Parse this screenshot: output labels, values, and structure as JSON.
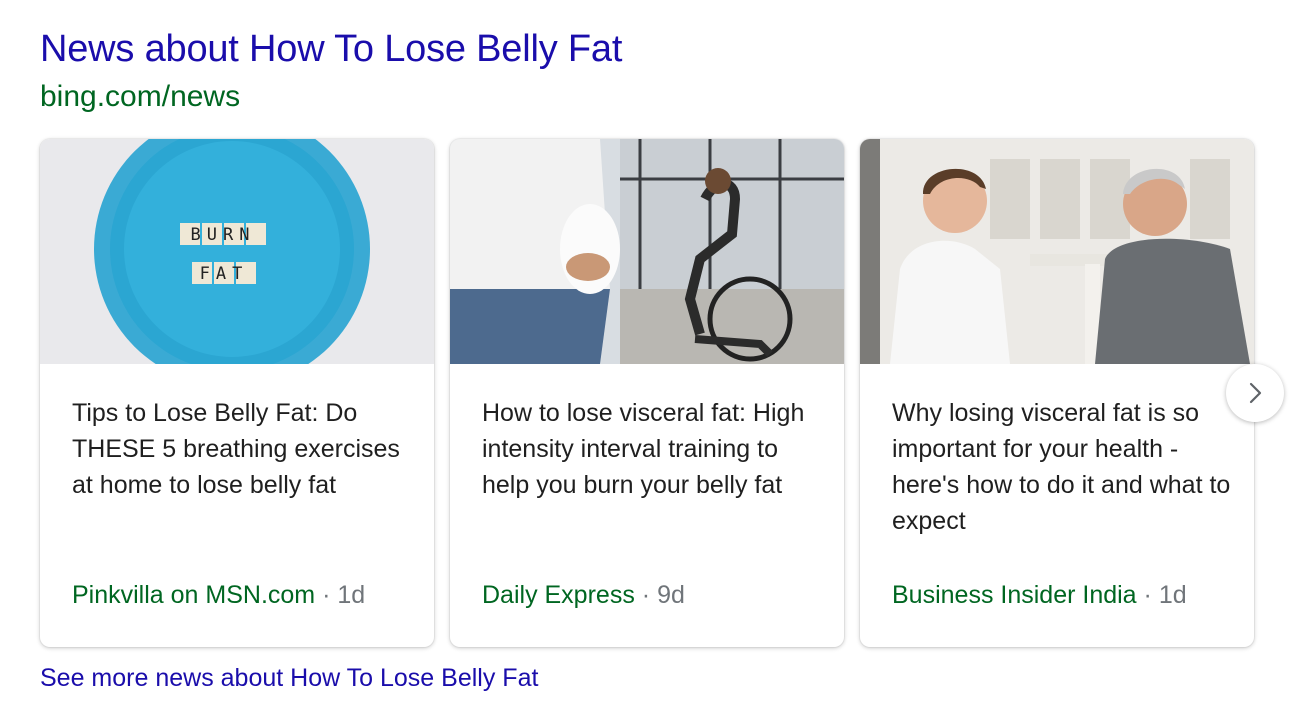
{
  "header": {
    "title": "News about How To Lose Belly Fat",
    "source": "bing.com/news"
  },
  "cards": [
    {
      "headline": "Tips to Lose Belly Fat: Do THESE 5 breathing exercises at home to lose belly fat",
      "source": "Pinkvilla on MSN.com",
      "separator": "·",
      "age": "1d",
      "image_text_1": "BURN",
      "image_text_2": "FAT"
    },
    {
      "headline": "How to lose visceral fat: High intensity interval training to help you burn your belly fat",
      "source": "Daily Express",
      "separator": "·",
      "age": "9d"
    },
    {
      "headline": "Why losing visceral fat is so important for your health - here's how to do it and what to expect",
      "source": "Business Insider India",
      "separator": "·",
      "age": "1d"
    }
  ],
  "carousel": {
    "next_icon": "chevron-right-icon"
  },
  "footer": {
    "see_more": "See more news about How To Lose Belly Fat"
  },
  "colors": {
    "title_link": "#1a0dab",
    "source_green": "#006621",
    "meta_gray": "#70757a"
  }
}
